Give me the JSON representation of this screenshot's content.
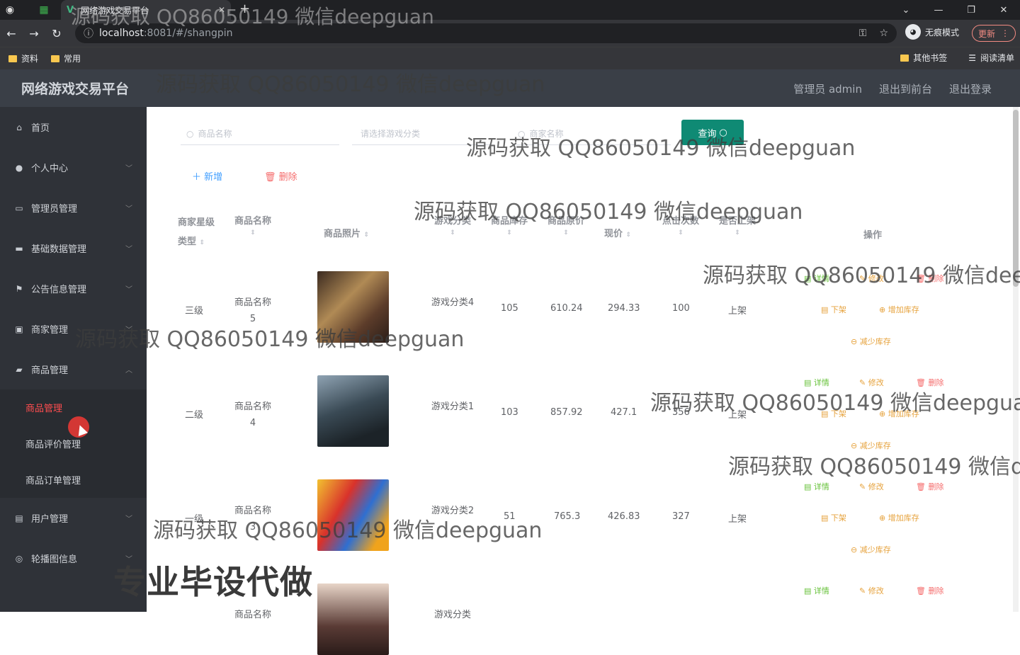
{
  "browser": {
    "tab_title": "网络游戏交易平台",
    "url_host": "localhost",
    "url_rest": ":8081/#/shangpin",
    "incognito_label": "无痕模式",
    "update_label": "更新",
    "bookmarks": [
      "资料",
      "常用"
    ],
    "bookmarks_right": [
      "其他书签",
      "阅读清单"
    ]
  },
  "header": {
    "brand": "网络游戏交易平台",
    "links": [
      "管理员 admin",
      "退出到前台",
      "退出登录"
    ]
  },
  "sidebar": {
    "items": [
      {
        "label": "首页",
        "icon": "home-icon"
      },
      {
        "label": "个人中心",
        "icon": "user-icon"
      },
      {
        "label": "管理员管理",
        "icon": "chat-icon"
      },
      {
        "label": "基础数据管理",
        "icon": "monitor-icon"
      },
      {
        "label": "公告信息管理",
        "icon": "flag-icon"
      },
      {
        "label": "商家管理",
        "icon": "store-icon"
      },
      {
        "label": "商品管理",
        "icon": "folder-icon"
      }
    ],
    "subitems": [
      "商品管理",
      "商品评价管理",
      "商品订单管理"
    ],
    "items_after": [
      {
        "label": "用户管理",
        "icon": "clipboard-icon"
      },
      {
        "label": "轮播图信息",
        "icon": "carousel-icon"
      }
    ]
  },
  "search": {
    "name_placeholder": "商品名称",
    "category_placeholder": "请选择游戏分类",
    "merchant_placeholder": "商家名称",
    "query_label": "查询"
  },
  "actions": {
    "add": "新增",
    "delete": "删除"
  },
  "table": {
    "headers": [
      "商家星级类型",
      "商品名称",
      "商品照片",
      "游戏分类",
      "商品库存",
      "商品原价",
      "现价",
      "点击次数",
      "是否上架",
      "操作"
    ],
    "rows": [
      {
        "level": "三级",
        "name": "商品名称5",
        "category": "游戏分类4",
        "stock": "105",
        "original": "610.24",
        "price": "294.33",
        "clicks": "100",
        "status": "上架"
      },
      {
        "level": "二级",
        "name": "商品名称4",
        "category": "游戏分类1",
        "stock": "103",
        "original": "857.92",
        "price": "427.1",
        "clicks": "356",
        "status": "上架"
      },
      {
        "level": "一级",
        "name": "商品名称3",
        "category": "游戏分类2",
        "stock": "51",
        "original": "765.3",
        "price": "426.83",
        "clicks": "327",
        "status": "上架"
      },
      {
        "level": "",
        "name": "商品名称",
        "category": "游戏分类",
        "stock": "",
        "original": "",
        "price": "",
        "clicks": "",
        "status": ""
      }
    ],
    "ops": {
      "detail": "详情",
      "edit": "修改",
      "remove": "删除",
      "off": "下架",
      "add_stock": "增加库存",
      "reduce_stock": "减少库存"
    }
  },
  "watermark": "源码获取 QQ86050149 微信deepguan",
  "promo_text": "专业毕设代做"
}
